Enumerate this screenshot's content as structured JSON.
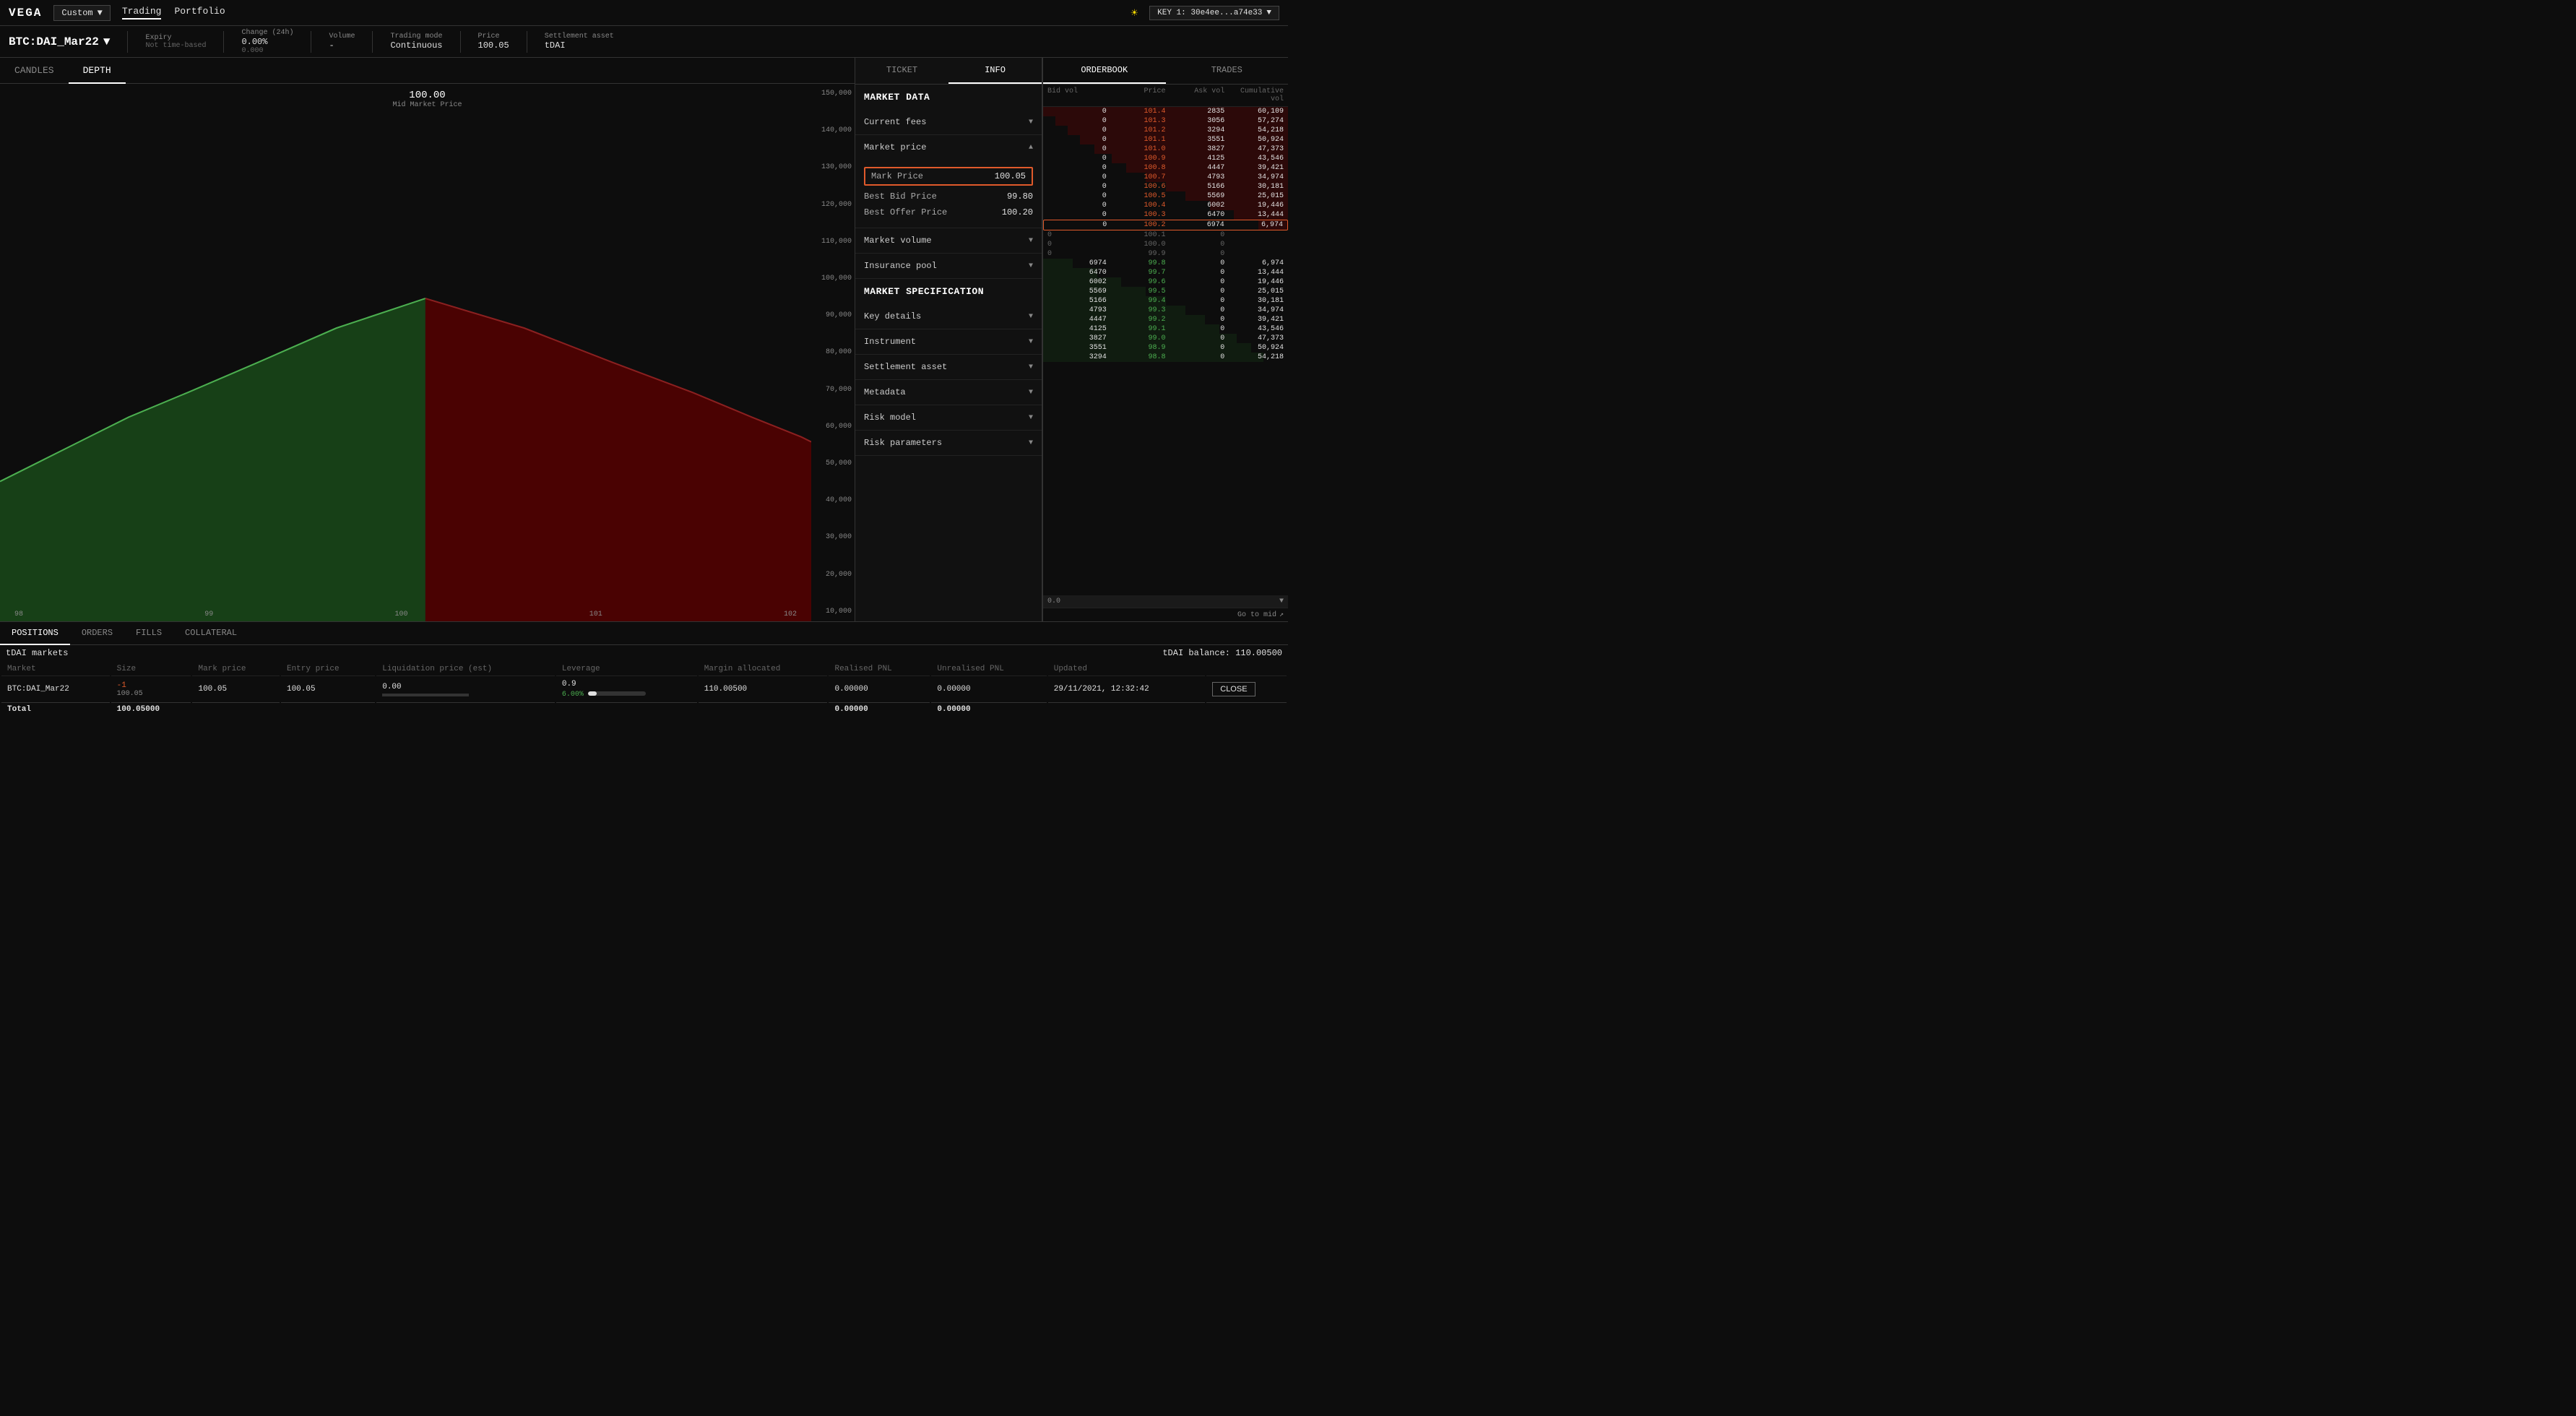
{
  "topNav": {
    "logo": "VEGA",
    "customLabel": "Custom",
    "navLinks": [
      "Trading",
      "Portfolio"
    ],
    "activeNav": "Trading",
    "keyLabel": "KEY 1: 30e4ee...a74e33"
  },
  "marketHeader": {
    "name": "BTC:DAI_Mar22",
    "expiry": {
      "label": "Expiry",
      "value": "Not time-based"
    },
    "change": {
      "label": "Change (24h)",
      "value": "0.00%",
      "sub": "0.000"
    },
    "volume": {
      "label": "Volume",
      "value": "-"
    },
    "tradingMode": {
      "label": "Trading mode",
      "value": "Continuous"
    },
    "price": {
      "label": "Price",
      "value": "100.05"
    },
    "settlement": {
      "label": "Settlement asset",
      "value": "tDAI"
    }
  },
  "chartTabs": [
    "CANDLES",
    "DEPTH"
  ],
  "activeChartTab": "DEPTH",
  "chart": {
    "midPrice": "100.00",
    "midLabel": "Mid Market Price",
    "yAxis": [
      "150,000",
      "140,000",
      "130,000",
      "120,000",
      "110,000",
      "100,000",
      "90,000",
      "80,000",
      "70,000",
      "60,000",
      "50,000",
      "40,000",
      "30,000",
      "20,000",
      "10,000"
    ],
    "xAxis": [
      "98",
      "99",
      "100",
      "101",
      "102"
    ]
  },
  "infoPanel": {
    "tabs": [
      "TICKET",
      "INFO"
    ],
    "activeTab": "INFO",
    "marketDataLabel": "MARKET DATA",
    "sections": [
      {
        "id": "current-fees",
        "label": "Current fees",
        "expanded": false
      },
      {
        "id": "market-price",
        "label": "Market price",
        "expanded": true,
        "items": [
          {
            "key": "Mark Price",
            "value": "100.05",
            "highlighted": true
          },
          {
            "key": "Best Bid Price",
            "value": "99.80",
            "highlighted": false
          },
          {
            "key": "Best Offer Price",
            "value": "100.20",
            "highlighted": false
          }
        ]
      },
      {
        "id": "market-volume",
        "label": "Market volume",
        "expanded": false
      },
      {
        "id": "insurance-pool",
        "label": "Insurance pool",
        "expanded": false
      }
    ],
    "specLabel": "MARKET SPECIFICATION",
    "specSections": [
      {
        "id": "key-details",
        "label": "Key details"
      },
      {
        "id": "instrument",
        "label": "Instrument"
      },
      {
        "id": "settlement-asset",
        "label": "Settlement asset"
      },
      {
        "id": "metadata",
        "label": "Metadata"
      },
      {
        "id": "risk-model",
        "label": "Risk model"
      },
      {
        "id": "risk-parameters",
        "label": "Risk parameters"
      }
    ]
  },
  "orderbook": {
    "tabs": [
      "ORDERBOOK",
      "TRADES"
    ],
    "activeTab": "ORDERBOOK",
    "headers": [
      "Bid vol",
      "Price",
      "Ask vol",
      "Cumulative vol"
    ],
    "askRows": [
      {
        "bidVol": "0",
        "price": "101.4",
        "askVol": "2835",
        "cumVol": "60,109",
        "barPct": 100
      },
      {
        "bidVol": "0",
        "price": "101.3",
        "askVol": "3056",
        "cumVol": "57,274",
        "barPct": 95
      },
      {
        "bidVol": "0",
        "price": "101.2",
        "askVol": "3294",
        "cumVol": "54,218",
        "barPct": 90
      },
      {
        "bidVol": "0",
        "price": "101.1",
        "askVol": "3551",
        "cumVol": "50,924",
        "barPct": 85
      },
      {
        "bidVol": "0",
        "price": "101.0",
        "askVol": "3827",
        "cumVol": "47,373",
        "barPct": 79
      },
      {
        "bidVol": "0",
        "price": "100.9",
        "askVol": "4125",
        "cumVol": "43,546",
        "barPct": 72
      },
      {
        "bidVol": "0",
        "price": "100.8",
        "askVol": "4447",
        "cumVol": "39,421",
        "barPct": 66
      },
      {
        "bidVol": "0",
        "price": "100.7",
        "askVol": "4793",
        "cumVol": "34,974",
        "barPct": 58
      },
      {
        "bidVol": "0",
        "price": "100.6",
        "askVol": "5166",
        "cumVol": "30,181",
        "barPct": 50
      },
      {
        "bidVol": "0",
        "price": "100.5",
        "askVol": "5569",
        "cumVol": "25,015",
        "barPct": 42
      },
      {
        "bidVol": "0",
        "price": "100.4",
        "askVol": "6002",
        "cumVol": "19,446",
        "barPct": 32
      },
      {
        "bidVol": "0",
        "price": "100.3",
        "askVol": "6470",
        "cumVol": "13,444",
        "barPct": 22
      },
      {
        "bidVol": "0",
        "price": "100.2",
        "askVol": "6974",
        "cumVol": "6,974",
        "barPct": 12,
        "highlighted": true
      }
    ],
    "midRows": [
      {
        "price": "100.1",
        "bidVol": "0",
        "askVol": "0"
      },
      {
        "price": "100.0",
        "bidVol": "0",
        "askVol": "0"
      },
      {
        "price": "99.9",
        "bidVol": "0",
        "askVol": "0"
      }
    ],
    "bidRows": [
      {
        "bidVol": "6974",
        "price": "99.8",
        "askVol": "0",
        "cumVol": "6,974",
        "barPct": 12
      },
      {
        "bidVol": "6470",
        "price": "99.7",
        "askVol": "0",
        "cumVol": "13,444",
        "barPct": 22
      },
      {
        "bidVol": "6002",
        "price": "99.6",
        "askVol": "0",
        "cumVol": "19,446",
        "barPct": 32
      },
      {
        "bidVol": "5569",
        "price": "99.5",
        "askVol": "0",
        "cumVol": "25,015",
        "barPct": 42
      },
      {
        "bidVol": "5166",
        "price": "99.4",
        "askVol": "0",
        "cumVol": "30,181",
        "barPct": 50
      },
      {
        "bidVol": "4793",
        "price": "99.3",
        "askVol": "0",
        "cumVol": "34,974",
        "barPct": 58
      },
      {
        "bidVol": "4447",
        "price": "99.2",
        "askVol": "0",
        "cumVol": "39,421",
        "barPct": 66
      },
      {
        "bidVol": "4125",
        "price": "99.1",
        "askVol": "0",
        "cumVol": "43,546",
        "barPct": 72
      },
      {
        "bidVol": "3827",
        "price": "99.0",
        "askVol": "0",
        "cumVol": "47,373",
        "barPct": 79
      },
      {
        "bidVol": "3551",
        "price": "98.9",
        "askVol": "0",
        "cumVol": "50,924",
        "barPct": 85
      },
      {
        "bidVol": "3294",
        "price": "98.8",
        "askVol": "0",
        "cumVol": "54,218",
        "barPct": 90
      }
    ],
    "midValue": "0.0",
    "gotoMid": "Go to mid"
  },
  "bottomPanel": {
    "tabs": [
      "POSITIONS",
      "ORDERS",
      "FILLS",
      "COLLATERAL"
    ],
    "activeTab": "POSITIONS",
    "tDaiMarketsLabel": "tDAI markets",
    "tDaiBalance": "tDAI balance: 110.00500",
    "tableHeaders": [
      "Market",
      "Size",
      "Mark price",
      "Entry price",
      "Liquidation price (est)",
      "Leverage",
      "Margin allocated",
      "Realised PNL",
      "Unrealised PNL",
      "Updated"
    ],
    "rows": [
      {
        "market": "BTC:DAI_Mar22",
        "size": "-1",
        "sizeExtra": "100.05",
        "markPrice": "100.05",
        "entryPrice": "100.05",
        "liquidationPrice": "0.00",
        "leverage": "0.9",
        "leveragePct": "6.00%",
        "marginAllocated": "110.00500",
        "realisedPNL": "0.00000",
        "unrealisedPNL": "0.00000",
        "updated": "29/11/2021, 12:32:42",
        "closeLabel": "CLOSE"
      }
    ],
    "totalRow": {
      "label": "Total",
      "total": "100.05000",
      "realisedPNL": "0.00000",
      "unrealisedPNL": "0.00000"
    }
  }
}
